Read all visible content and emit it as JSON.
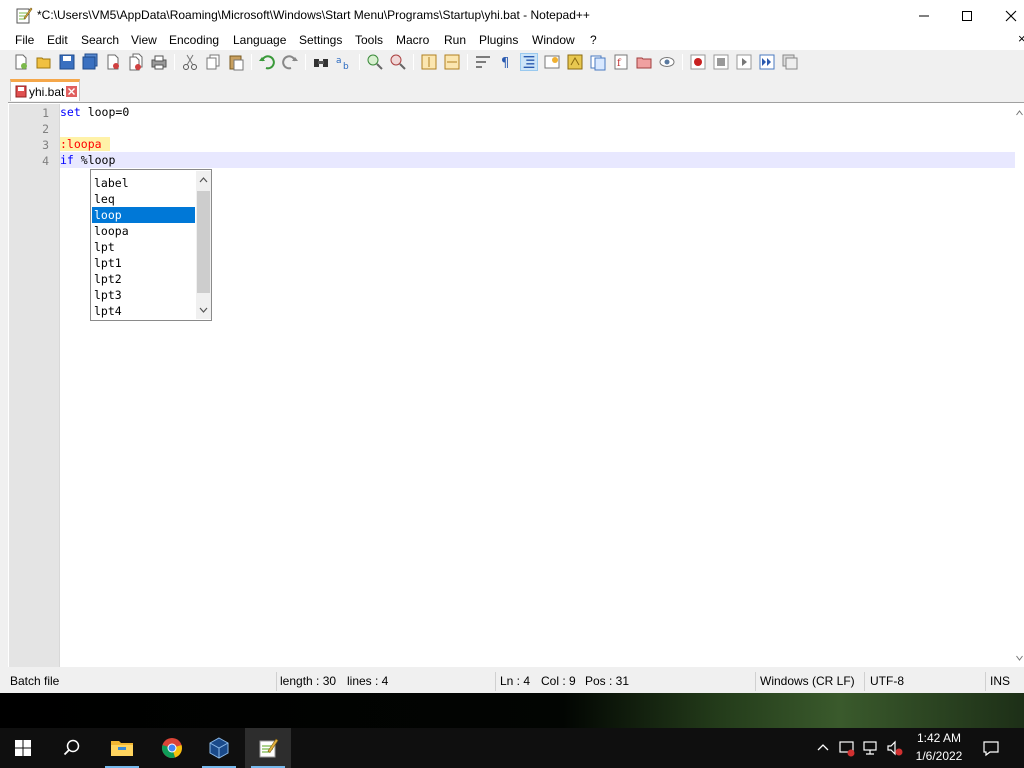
{
  "window": {
    "title": "*C:\\Users\\VM5\\AppData\\Roaming\\Microsoft\\Windows\\Start Menu\\Programs\\Startup\\yhi.bat - Notepad++"
  },
  "menu": {
    "items": [
      "File",
      "Edit",
      "Search",
      "View",
      "Encoding",
      "Language",
      "Settings",
      "Tools",
      "Macro",
      "Run",
      "Plugins",
      "Window",
      "?"
    ],
    "extra_close": "×"
  },
  "toolbar": {
    "icons": [
      "new-file-icon",
      "open-file-icon",
      "save-icon",
      "save-all-icon",
      "close-icon",
      "close-all-icon",
      "print-icon",
      "cut-icon",
      "copy-icon",
      "paste-icon",
      "undo-icon",
      "redo-icon",
      "find-icon",
      "replace-icon",
      "zoom-in-icon",
      "zoom-out-icon",
      "sync-vertical-icon",
      "sync-horizontal-icon",
      "word-wrap-icon",
      "show-all-chars-icon",
      "indent-guide-icon",
      "user-language-icon",
      "document-map-icon",
      "document-list-icon",
      "function-list-icon",
      "folder-workspace-icon",
      "monitoring-icon",
      "record-macro-icon",
      "stop-recording-icon",
      "play-macro-icon",
      "run-macro-multiple-icon",
      "save-macro-icon"
    ]
  },
  "tabs": [
    {
      "label": "yhi.bat",
      "modified": true
    }
  ],
  "editor": {
    "lines": [
      {
        "number": "1",
        "keyword": "set",
        "rest": " loop=0"
      },
      {
        "number": "2",
        "keyword": "",
        "rest": ""
      },
      {
        "number": "3",
        "label": ":loopa"
      },
      {
        "number": "4",
        "keyword": "if",
        "rest": " %loop"
      }
    ]
  },
  "autocomplete": {
    "items": [
      "label",
      "leq",
      "loop",
      "loopa",
      "lpt",
      "lpt1",
      "lpt2",
      "lpt3",
      "lpt4"
    ],
    "selected": "loop"
  },
  "status": {
    "language": "Batch file",
    "length": "length : 30",
    "lines": "lines : 4",
    "ln": "Ln : 4",
    "col": "Col : 9",
    "pos": "Pos : 31",
    "eol": "Windows (CR LF)",
    "encoding": "UTF-8",
    "mode": "INS"
  },
  "taskbar": {
    "apps": [
      "start-icon",
      "search-icon",
      "file-explorer-icon",
      "chrome-icon",
      "virtualbox-icon",
      "notepadpp-icon"
    ],
    "time": "1:42 AM",
    "date": "1/6/2022"
  },
  "colors": {
    "keyword": "#0000ff",
    "label_text": "#ff0000",
    "label_bg": "#fff2a8",
    "current_line": "#e8e8ff",
    "selection": "#0078d7",
    "tab_accent": "#f5a74a"
  }
}
